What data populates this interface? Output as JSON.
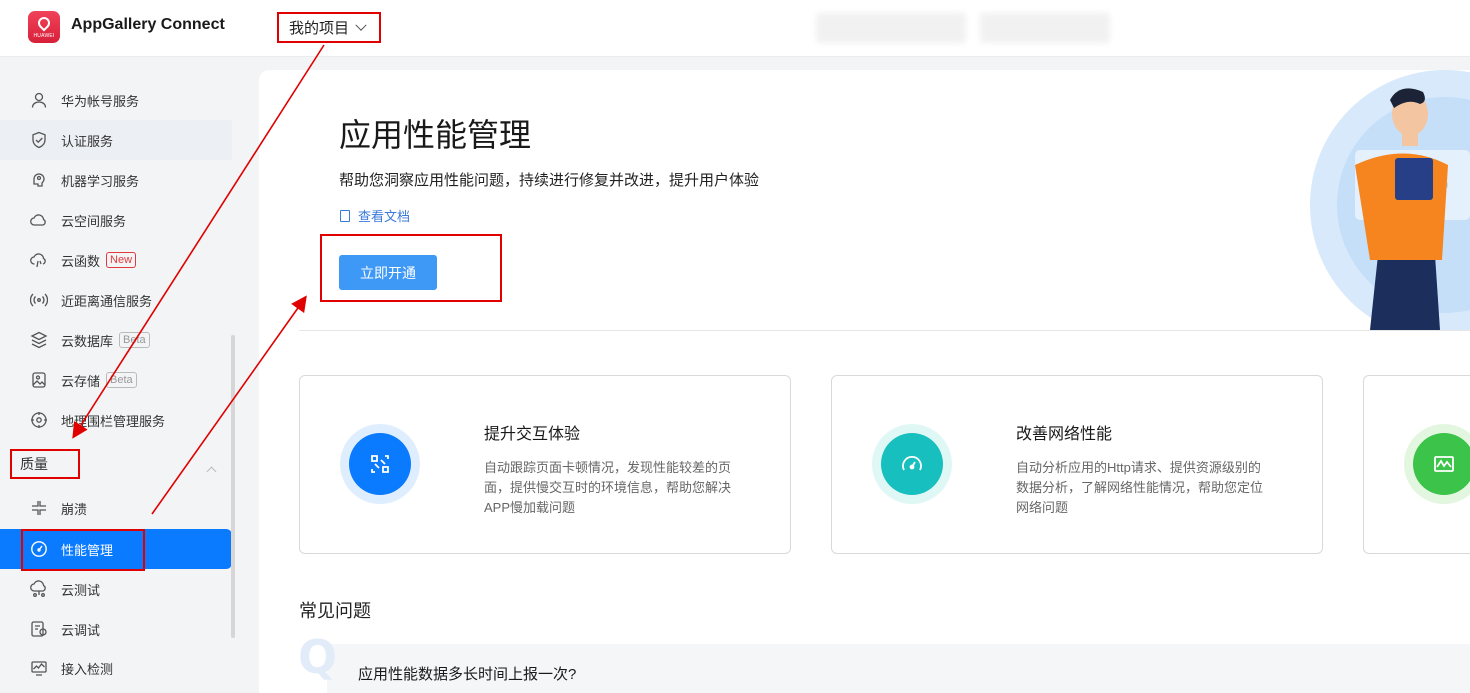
{
  "header": {
    "brand_logo_text": "HUAWEI",
    "app_title": "AppGallery Connect",
    "project_selector": "我的项目"
  },
  "sidebar": {
    "items": [
      {
        "label": "华为帐号服务",
        "icon": "user-icon"
      },
      {
        "label": "认证服务",
        "icon": "shield-icon"
      },
      {
        "label": "机器学习服务",
        "icon": "brain-icon"
      },
      {
        "label": "云空间服务",
        "icon": "cloud-icon"
      },
      {
        "label": "云函数",
        "icon": "cloud-function-icon",
        "tag": "New"
      },
      {
        "label": "近距离通信服务",
        "icon": "nearby-icon"
      },
      {
        "label": "云数据库",
        "icon": "database-icon",
        "tag": "Beta"
      },
      {
        "label": "云存储",
        "icon": "storage-icon",
        "tag": "Beta"
      },
      {
        "label": "地理围栏管理服务",
        "icon": "geofence-icon"
      }
    ],
    "section_label": "质量",
    "quality_items": [
      {
        "label": "崩溃",
        "icon": "crash-icon"
      },
      {
        "label": "性能管理",
        "icon": "gauge-icon"
      },
      {
        "label": "云测试",
        "icon": "cloud-test-icon"
      },
      {
        "label": "云调试",
        "icon": "cloud-debug-icon"
      },
      {
        "label": "接入检测",
        "icon": "monitor-icon"
      }
    ]
  },
  "hero": {
    "title": "应用性能管理",
    "subtitle": "帮助您洞察应用性能问题，持续进行修复并改进，提升用户体验",
    "doc_link": "查看文档",
    "cta": "立即开通"
  },
  "cards": [
    {
      "title": "提升交互体验",
      "desc": "自动跟踪页面卡顿情况，发现性能较差的页面，提供慢交互时的环境信息，帮助您解决APP慢加载问题",
      "color": "#0a7aff",
      "ring": "#dfeefe",
      "icon": "interaction-icon"
    },
    {
      "title": "改善网络性能",
      "desc": "自动分析应用的Http请求、提供资源级别的数据分析，了解网络性能情况，帮助您定位网络问题",
      "color": "#17bfbf",
      "ring": "#dff7f5",
      "icon": "speedometer-icon"
    },
    {
      "color": "#3cc44a",
      "ring": "#e3f6e0",
      "icon": "chart-icon"
    }
  ],
  "faq": {
    "title": "常见问题",
    "question": "应用性能数据多长时间上报一次?"
  },
  "annotation_color": "#e00000"
}
